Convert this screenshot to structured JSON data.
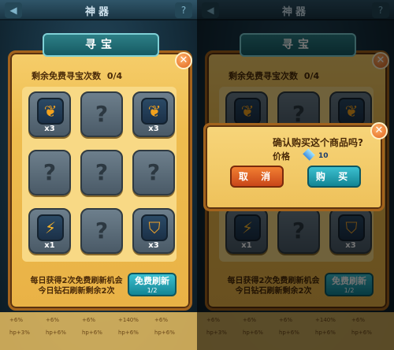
{
  "header": {
    "title": "神器"
  },
  "panel": {
    "banner": "寻宝",
    "free_label": "剩余免费寻宝次数",
    "free_count": "0/4",
    "slots": [
      {
        "state": "revealed",
        "icon": "wing-icon",
        "glyph": "❦",
        "qty": "x3"
      },
      {
        "state": "hidden",
        "glyph": "?",
        "qty": ""
      },
      {
        "state": "revealed",
        "icon": "wing-icon",
        "glyph": "❦",
        "qty": "x3"
      },
      {
        "state": "hidden",
        "glyph": "?",
        "qty": ""
      },
      {
        "state": "hidden",
        "glyph": "?",
        "qty": ""
      },
      {
        "state": "hidden",
        "glyph": "?",
        "qty": ""
      },
      {
        "state": "revealed",
        "icon": "lightning-icon",
        "glyph": "⚡",
        "qty": "x1"
      },
      {
        "state": "hidden",
        "glyph": "?",
        "qty": ""
      },
      {
        "state": "revealed",
        "icon": "shield-icon",
        "glyph": "⛉",
        "qty": "x3"
      }
    ],
    "info_line1": "每日获得2次免费刷新机会",
    "info_line2": "今日钻石刷新剩余2次",
    "refresh_label": "免费刷新",
    "refresh_count": "1/2"
  },
  "footer": {
    "stats": [
      "+6%",
      "+6%",
      "+6%",
      "+140%",
      "+6%",
      "hp+3%",
      "hp+6%",
      "hp+6%",
      "hp+6%",
      "hp+6%"
    ]
  },
  "dialog": {
    "question": "确认购买这个商品吗?",
    "price_label": "价格",
    "price_value": "10",
    "cancel_label": "取 消",
    "buy_label": "购 买"
  },
  "colors": {
    "panel": "#efbd4f",
    "accent_teal": "#138594",
    "accent_orange": "#c9471a"
  }
}
